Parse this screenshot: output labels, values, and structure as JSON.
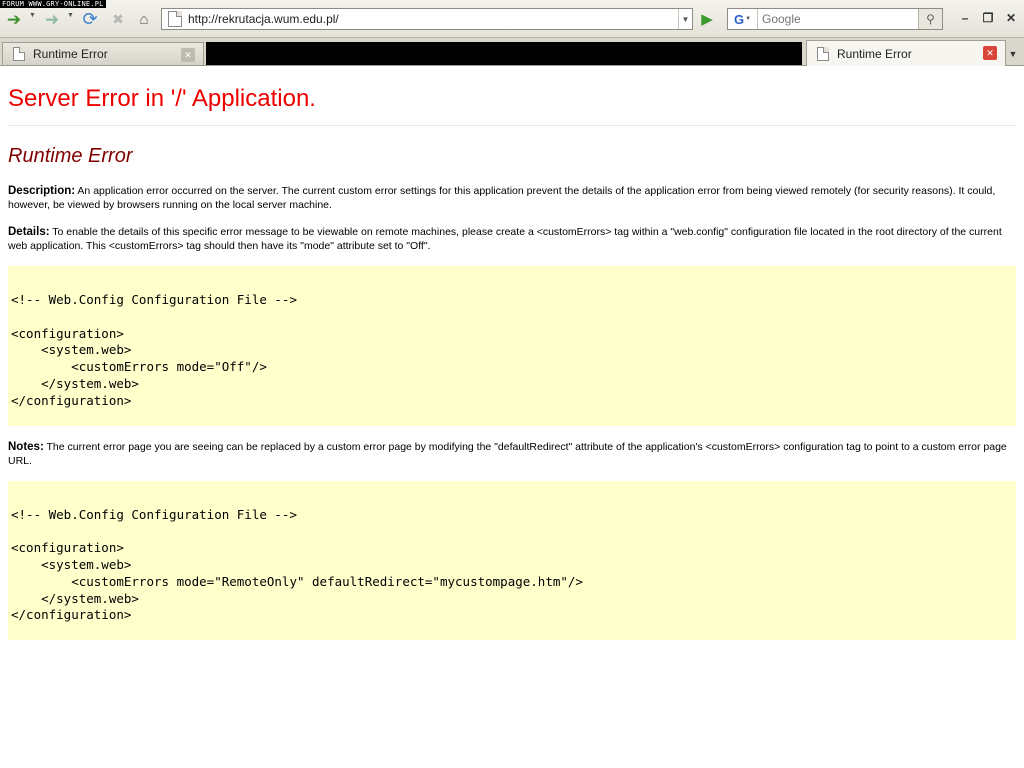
{
  "watermark": "FORUM WWW.GRY-ONLINE.PL",
  "toolbar": {
    "back_icon": "back-arrow-icon",
    "forward_icon": "forward-arrow-icon",
    "reload_icon": "reload-icon",
    "stop_icon": "stop-icon",
    "home_icon": "home-icon",
    "url": "http://rekrutacja.wum.edu.pl/",
    "search_placeholder": "Google",
    "search_engine": "G"
  },
  "tabs": [
    {
      "label": "Runtime Error",
      "active": false
    },
    {
      "label": "",
      "redacted": true
    },
    {
      "label": "",
      "redacted": true
    },
    {
      "label": "",
      "redacted": true
    },
    {
      "label": "Runtime Error",
      "active": true
    }
  ],
  "page": {
    "title": "Server Error in '/' Application.",
    "subtitle": "Runtime Error",
    "description_label": "Description:",
    "description_text": " An application error occurred on the server. The current custom error settings for this application prevent the details of the application error from being viewed remotely (for security reasons). It could, however, be viewed by browsers running on the local server machine.",
    "details_label": "Details:",
    "details_text": " To enable the details of this specific error message to be viewable on remote machines, please create a <customErrors> tag within a \"web.config\" configuration file located in the root directory of the current web application. This <customErrors> tag should then have its \"mode\" attribute set to \"Off\".",
    "code1": "<!-- Web.Config Configuration File -->\n\n<configuration>\n    <system.web>\n        <customErrors mode=\"Off\"/>\n    </system.web>\n</configuration>",
    "notes_label": "Notes:",
    "notes_text": " The current error page you are seeing can be replaced by a custom error page by modifying the \"defaultRedirect\" attribute of the application's <customErrors> configuration tag to point to a custom error page URL.",
    "code2": "<!-- Web.Config Configuration File -->\n\n<configuration>\n    <system.web>\n        <customErrors mode=\"RemoteOnly\" defaultRedirect=\"mycustompage.htm\"/>\n    </system.web>\n</configuration>"
  },
  "colors": {
    "title": "#ff0000",
    "subtitle": "#800000",
    "code_bg": "#ffffcc"
  }
}
